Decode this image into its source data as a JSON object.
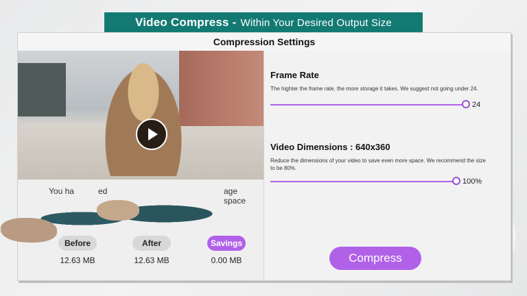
{
  "banner": {
    "title": "Video Compress",
    "dash": "-",
    "subtitle": "Within Your Desired Output Size"
  },
  "window": {
    "title": "Compression Settings"
  },
  "left": {
    "message_start": "You ha",
    "message_mid": "ed",
    "message_end": "age space",
    "stats": [
      {
        "label": "Before",
        "value": "12.63  MB",
        "style": "gray"
      },
      {
        "label": "After",
        "value": "12.63  MB",
        "style": "gray"
      },
      {
        "label": "Savings",
        "value": "0.00 MB",
        "style": "purple"
      }
    ]
  },
  "right": {
    "frame_rate": {
      "title": "Frame Rate",
      "description": "The highter the frame rate, the more storage it takes. We suggest not going under 24.",
      "value": "24"
    },
    "dimensions": {
      "title": "Video Dimensions : 640x360",
      "description": "Reduce the dimensions of your video to save even more space. We recommend the size to be 80%.",
      "value": "100%"
    },
    "compress_label": "Compress"
  },
  "colors": {
    "banner": "#137a73",
    "accent": "#b061e8"
  }
}
